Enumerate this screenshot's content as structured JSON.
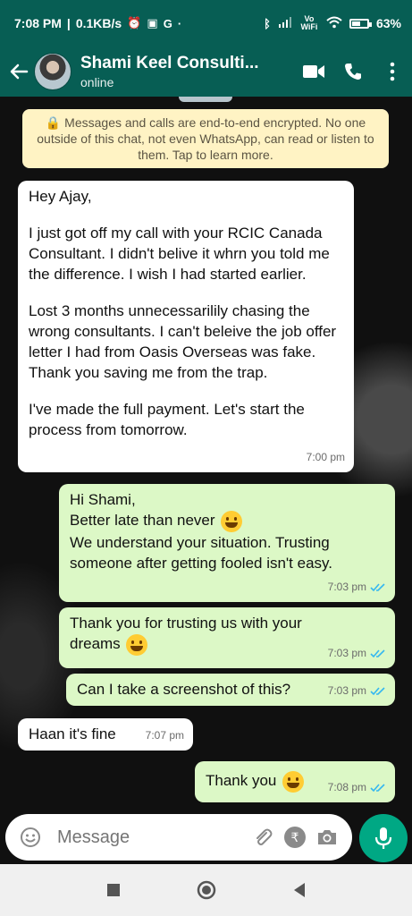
{
  "status_bar": {
    "time": "7:08 PM",
    "speed": "0.1KB/s",
    "network_label": "Vo WiFi",
    "battery": "63%",
    "battery_level": 0.63
  },
  "header": {
    "contact_name": "Shami Keel Consulti...",
    "presence": "online"
  },
  "encryption_notice": "Messages and calls are end-to-end encrypted. No one outside of this chat, not even WhatsApp, can read or listen to them. Tap to learn more.",
  "messages": [
    {
      "direction": "in",
      "paragraphs": [
        "Hey Ajay,",
        "I just got off my call with your RCIC Canada Consultant. I didn't belive it whrn you told me the difference. I wish I had started earlier.",
        "Lost 3 months unnecessarilily chasing the wrong consultants. I can't beleive the job offer letter I had from Oasis Overseas was fake. Thank you saving me from the trap.",
        "I've made the full payment. Let's start the process from tomorrow."
      ],
      "time": "7:00 pm"
    },
    {
      "direction": "out",
      "line1": "Hi Shami,",
      "line2": "Better late than never",
      "line3": "We understand your situation. Trusting someone after getting fooled isn't easy.",
      "time": "7:03 pm"
    },
    {
      "direction": "out",
      "line1": "Thank you for trusting us with your",
      "line2": "dreams",
      "time": "7:03 pm"
    },
    {
      "direction": "out",
      "text": "Can I take a screenshot of this?",
      "time": "7:03 pm"
    },
    {
      "direction": "in",
      "text": "Haan it's fine",
      "time": "7:07 pm"
    },
    {
      "direction": "out",
      "text": "Thank you",
      "time": "7:08 pm"
    }
  ],
  "composer": {
    "placeholder": "Message"
  },
  "colors": {
    "header": "#075E54",
    "outgoing_bubble": "#DCF8C6",
    "incoming_bubble": "#FFFFFF",
    "notice": "#FFF3C4",
    "accent": "#00A884",
    "tick": "#34B7F1"
  },
  "icons": {
    "back": "arrow-left-icon",
    "video": "video-call-icon",
    "call": "phone-icon",
    "menu": "more-vert-icon",
    "emoji": "emoji-icon",
    "attach": "paperclip-icon",
    "payment": "rupee-icon",
    "camera": "camera-icon",
    "mic": "microphone-icon"
  }
}
